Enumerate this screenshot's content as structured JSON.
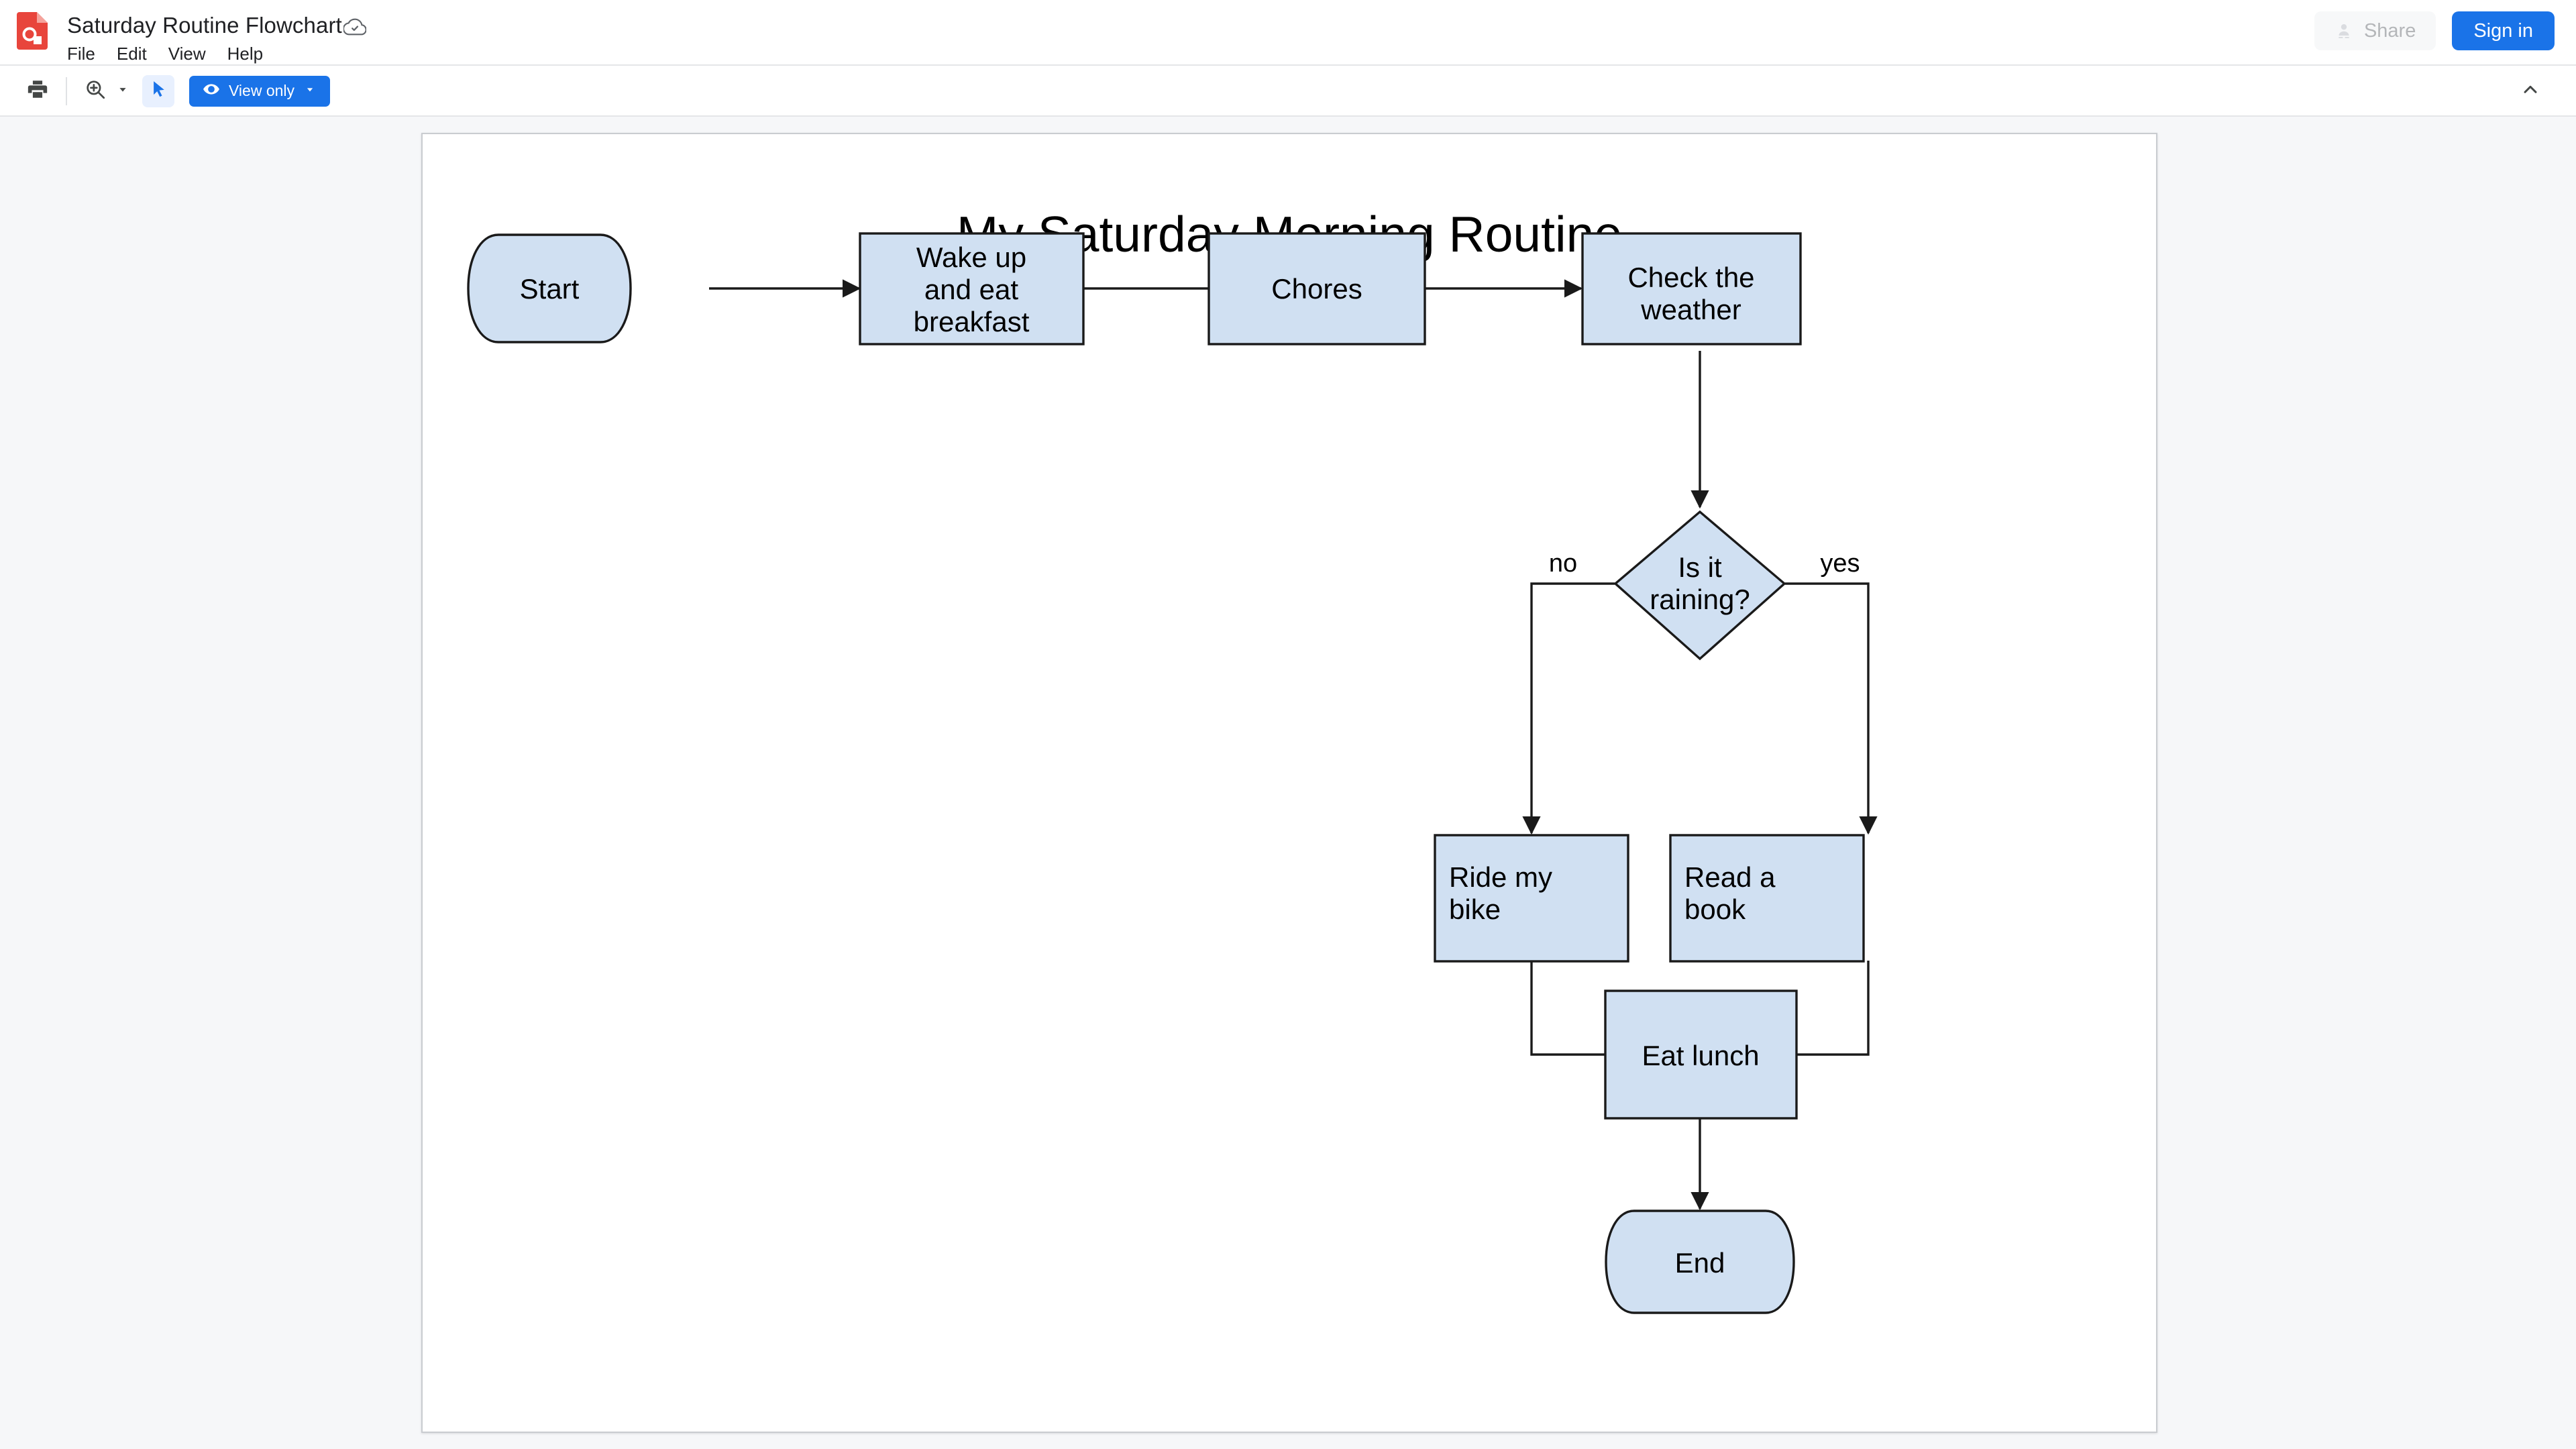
{
  "app": {
    "logo_icon": "google-drawings-logo",
    "doc_title": "Saturday Routine Flowchart",
    "cloud_icon": "cloud-saved-icon",
    "menus": [
      {
        "label": "File"
      },
      {
        "label": "Edit"
      },
      {
        "label": "View"
      },
      {
        "label": "Help"
      }
    ],
    "share_label": "Share",
    "share_icon": "person-add-icon",
    "signin_label": "Sign in"
  },
  "toolbar": {
    "print_icon": "print-icon",
    "zoom_icon": "zoom-in-icon",
    "zoom_caret_icon": "chevron-down-icon",
    "cursor_icon": "select-arrow-icon",
    "view_only_label": "View only",
    "view_only_icon": "eye-icon",
    "collapse_icon": "chevron-up-icon"
  },
  "canvas": {
    "title": "My Saturday Morning Routine",
    "shape_fill": "#d0e0f2",
    "shape_stroke": "#1a1a1a",
    "page_background": "#ffffff"
  },
  "chart_data": {
    "type": "diagram",
    "title": "My Saturday Morning Routine",
    "nodes": [
      {
        "id": "start",
        "label": "Start",
        "shape": "terminator",
        "align": "center"
      },
      {
        "id": "wake",
        "label": "Wake up\nand eat\nbreakfast",
        "shape": "process",
        "align": "center"
      },
      {
        "id": "chores",
        "label": "Chores",
        "shape": "process",
        "align": "center"
      },
      {
        "id": "weather",
        "label": "Check the\nweather",
        "shape": "process",
        "align": "center"
      },
      {
        "id": "raining",
        "label": "Is it\nraining?",
        "shape": "decision",
        "align": "center"
      },
      {
        "id": "bike",
        "label": "Ride my\nbike",
        "shape": "process",
        "align": "left"
      },
      {
        "id": "book",
        "label": "Read a\nbook",
        "shape": "process",
        "align": "left"
      },
      {
        "id": "lunch",
        "label": "Eat lunch",
        "shape": "process",
        "align": "center"
      },
      {
        "id": "end",
        "label": "End",
        "shape": "terminator",
        "align": "center"
      }
    ],
    "edges": [
      {
        "from": "start",
        "to": "wake",
        "label": ""
      },
      {
        "from": "wake",
        "to": "chores",
        "label": ""
      },
      {
        "from": "chores",
        "to": "weather",
        "label": ""
      },
      {
        "from": "weather",
        "to": "raining",
        "label": ""
      },
      {
        "from": "raining",
        "to": "bike",
        "label": "no"
      },
      {
        "from": "raining",
        "to": "book",
        "label": "yes"
      },
      {
        "from": "bike",
        "to": "lunch",
        "label": ""
      },
      {
        "from": "book",
        "to": "lunch",
        "label": ""
      },
      {
        "from": "lunch",
        "to": "end",
        "label": ""
      }
    ],
    "labels": {
      "title": "My Saturday Morning Routine",
      "node_start": "Start",
      "node_wake_l1": "Wake up",
      "node_wake_l2": "and eat",
      "node_wake_l3": "breakfast",
      "node_chores": "Chores",
      "node_weather_l1": "Check the",
      "node_weather_l2": "weather",
      "node_raining_l1": "Is it",
      "node_raining_l2": "raining?",
      "node_bike_l1": "Ride my",
      "node_bike_l2": "bike",
      "node_book_l1": "Read a",
      "node_book_l2": "book",
      "node_lunch": "Eat lunch",
      "node_end": "End",
      "edge_no": "no",
      "edge_yes": "yes"
    }
  }
}
